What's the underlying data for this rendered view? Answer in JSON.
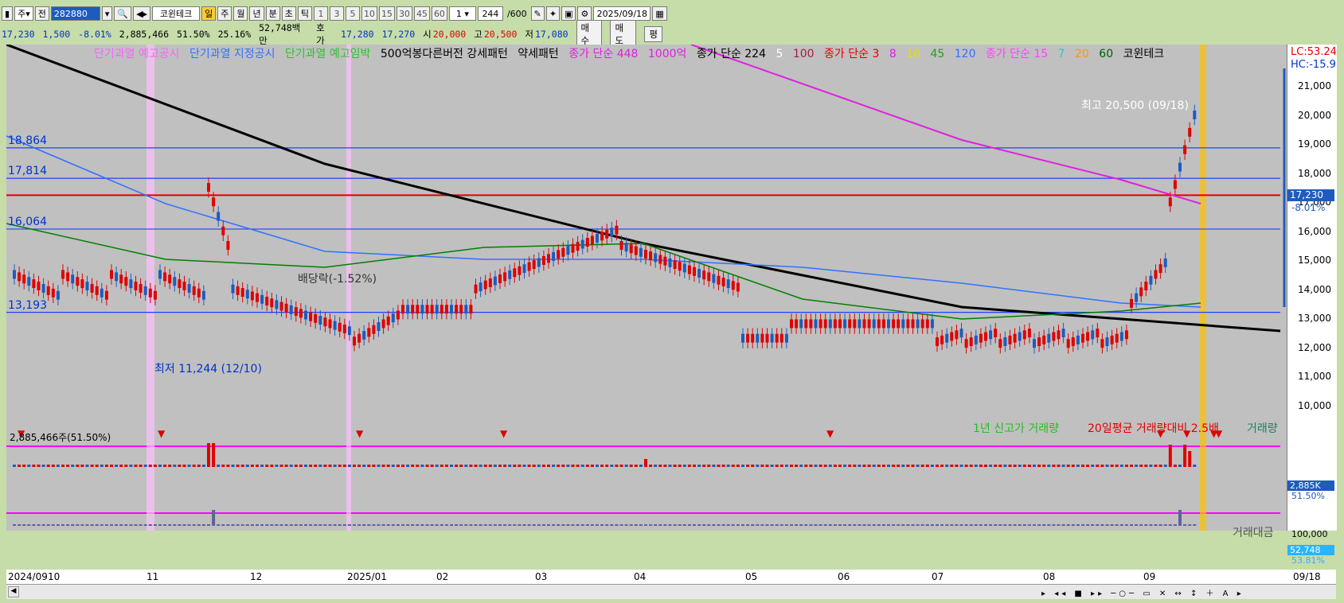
{
  "toolbar": {
    "period_select": "주",
    "prev_label": "전",
    "stock_code": "282880",
    "stock_name": "코윈테크",
    "timeframes": [
      "일",
      "주",
      "월",
      "년"
    ],
    "minute_btns": [
      "분",
      "초",
      "틱"
    ],
    "intervals": [
      "1",
      "3",
      "5",
      "10",
      "15",
      "30",
      "45",
      "60"
    ],
    "interval_select": "1",
    "count_value": "244",
    "count_total": "/600",
    "date_value": "2025/09/18"
  },
  "pricebar": {
    "price": "17,230",
    "change": "1,500",
    "change_pct": "-8.01%",
    "volume": "2,885,466",
    "vol_pct": "51.50%",
    "turnover_pct": "25.16%",
    "amount": "52,748백만",
    "bid_label": "호가",
    "bid1": "17,280",
    "bid2": "17,270",
    "open_label": "시",
    "open": "20,000",
    "high_label": "고",
    "high": "20,500",
    "low_label": "저",
    "low": "17,080",
    "buy_btn": "매수",
    "sell_btn": "매도",
    "eval_btn": "평"
  },
  "legend": {
    "items": [
      "단기과열 예고공시",
      "단기과열 지정공시",
      "단기과열 예고임박",
      "500억봉다른버전 강세패턴",
      "약세패턴",
      "종가 단순 448",
      "1000억",
      "종가 단순 224",
      "5",
      "100",
      "종가 단순 3",
      "8",
      "10",
      "45",
      "120",
      "종가 단순 15",
      "7",
      "20",
      "60",
      "코윈테크"
    ],
    "lc": "LC:53.24",
    "hc": "HC:-15.9"
  },
  "price_levels": {
    "l1": "18,864",
    "l2": "17,814",
    "l3": "16,064",
    "l4": "13,193"
  },
  "annotations": {
    "high": "최고 20,500 (09/18)",
    "low": "최저 11,244 (12/10)",
    "dividend": "배당락(-1.52%)"
  },
  "right_axis": [
    "21,000",
    "20,000",
    "19,000",
    "18,000",
    "17,000",
    "16,000",
    "15,000",
    "14,000",
    "13,000",
    "12,000",
    "11,000",
    "10,000"
  ],
  "current_price_tag": "17,230",
  "current_pct_tag": "-8.01%",
  "volume_panel": {
    "title": "2,885,466주(51.50%)",
    "legend": [
      "1년 신고가 거래량",
      "20일평균 거래량대비 2.5배",
      "거래량"
    ],
    "tag1": "2,885K",
    "tag2": "51.50%",
    "amount_legend": "거래대금",
    "amount_axis": "100,000",
    "amount_tag1": "52,748",
    "amount_tag2": "53.81%"
  },
  "dates": [
    "2024/09",
    "10",
    "11",
    "12",
    "2025/01",
    "02",
    "03",
    "04",
    "05",
    "06",
    "07",
    "08",
    "09",
    "09/18"
  ],
  "colors": {
    "up": "#e00000",
    "down": "#1e5bbf",
    "ma448": "#e020e0",
    "ma224": "#000000",
    "accent": "#ffcc00"
  }
}
